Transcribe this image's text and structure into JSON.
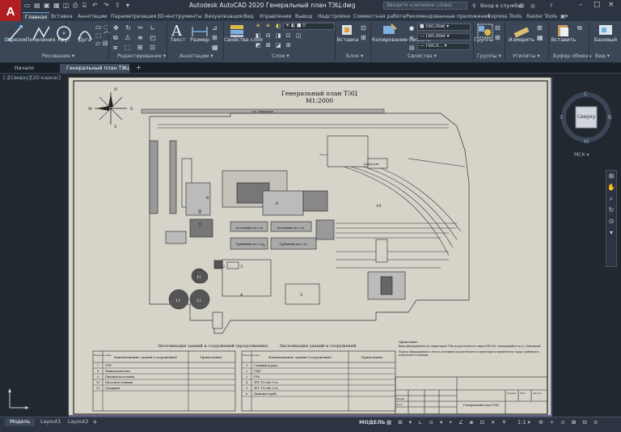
{
  "app": {
    "logo": "A",
    "title": "Autodesk AutoCAD 2020   Генеральный план ТЭЦ.dwg",
    "search_placeholder": "Введите ключевое слово/фразу",
    "signin": "Вход в службы",
    "help": "?"
  },
  "tabs": [
    "Главная",
    "Вставка",
    "Аннотации",
    "Параметризация",
    "3D-инструменты",
    "Визуализация",
    "Вид",
    "Управление",
    "Вывод",
    "Надстройки",
    "Совместная работа",
    "Рекомендованные приложения",
    "Express Tools",
    "Raster Tools"
  ],
  "ribbon": {
    "draw": {
      "line": "Отрезок",
      "polyline": "Полилиния",
      "circle": "Круг",
      "arc": "Дуга",
      "panel": "Рисование"
    },
    "modify": {
      "panel": "Редактирование"
    },
    "annotation": {
      "text": "Текст",
      "dimension": "Размер",
      "panel": "Аннотации"
    },
    "layers": {
      "props": "Свойства слоя",
      "current": "0",
      "panel": "Слои"
    },
    "block": {
      "insert": "Вставка",
      "panel": "Блок"
    },
    "properties": {
      "match": "Копирование свойств",
      "bylayer1": "ПоСлою",
      "bylayer2": "ПоСлою",
      "bylayer3": "ПоСл...",
      "panel": "Свойства"
    },
    "groups": {
      "group": "Группа",
      "panel": "Группы"
    },
    "utilities": {
      "measure": "Измерить",
      "panel": "Утилиты"
    },
    "clipboard": {
      "paste": "Вставить",
      "panel": "Буфер обмена"
    },
    "view": {
      "base": "Базовый",
      "panel": "Вид"
    }
  },
  "doc_tabs": [
    "Начало",
    "Генеральный план ТЭЦ"
  ],
  "viewport_label": "[-][Сверху][2D-каркас]",
  "viewcube": {
    "label": "Сверху",
    "n": "С",
    "s": "Ю",
    "w": "З",
    "e": "В",
    "ucs": "МСК"
  },
  "drawing": {
    "title": "Генеральный план ТЭЦ",
    "scale": "М1:2000",
    "compass": {
      "n": "N",
      "s": "S",
      "w": "W",
      "e": "E"
    },
    "plan_labels": {
      "road": "ул. Заводская",
      "b1": "1",
      "b2": "2",
      "b3": "3",
      "b4": "4",
      "b5": "5",
      "b6": "6",
      "b7": "7",
      "b8": "8",
      "b9": "9",
      "b10": "10",
      "b11a": "11",
      "b11b": "11",
      "b11c": "11",
      "b11d": "11",
      "tank1": "Котельный зал 1 оч.",
      "tank2": "Котельный зал 2 оч.",
      "turb1": "Турбинный зал 1 оч.",
      "turb2": "Турбинный зал 2 оч.",
      "coal": "Склад угля"
    },
    "expl_left": {
      "title": "Экспликация зданий и сооружений (продолжение)",
      "h_num": "Номер на плане",
      "h_name": "Наименование здания (сооружения)",
      "h_note": "Примечание",
      "rows": [
        [
          "7",
          "ГРП"
        ],
        [
          "8",
          "Химводоочистка"
        ],
        [
          "9",
          "Пиковая котельная"
        ],
        [
          "10",
          "Насосная станция"
        ],
        [
          "11",
          "Градирни"
        ]
      ]
    },
    "expl_right": {
      "title": "Экспликация зданий и сооружений",
      "h_num": "Номер на плане",
      "h_name": "Наименование здания (сооружения)",
      "h_note": "Примечание",
      "rows": [
        [
          "1",
          "Главный корпус"
        ],
        [
          "2",
          "ГЩУ"
        ],
        [
          "3",
          "РУ6"
        ],
        [
          "4",
          "ЗРУ 110 кВ 1 оч."
        ],
        [
          "5",
          "ЗРУ 110 кВ 2 оч."
        ],
        [
          "6",
          "Дымовая труба"
        ]
      ]
    },
    "notes": {
      "head": "Примечание.",
      "n1": "Ввод оборудования на территорию ТЭЦ осуществляется через КПП №2, находящийся по ул. Заводской.",
      "n2": "Подача оборудования к месту установки осуществляется через ворота временного торца турбинного отделения II очереди."
    },
    "stamp": {
      "name": "Генеральный план ТЭЦ",
      "stage": "Стадия",
      "sheet": "Лист",
      "sheets": "Листов",
      "dev": "Разраб.",
      "chk": "Пров."
    }
  },
  "status": {
    "layouts": [
      "Модель",
      "Layout1",
      "Layout2"
    ],
    "model": "МОДЕЛЬ",
    "scale": "1:1"
  }
}
